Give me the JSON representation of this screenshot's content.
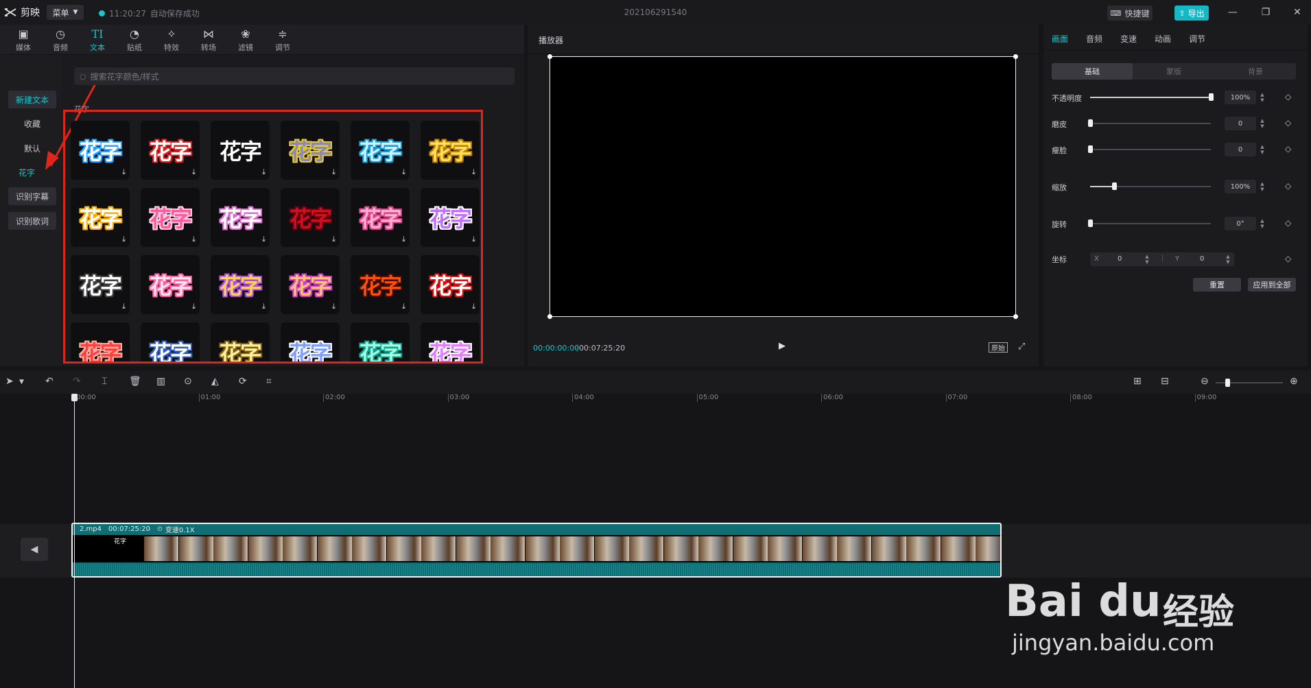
{
  "titlebar": {
    "logo": "剪映",
    "menu": "菜单",
    "autosave_time": "11:20:27",
    "autosave_text": "自动保存成功",
    "project_title": "202106291540",
    "shortcut": "快捷键",
    "export": "导出"
  },
  "toolbar": {
    "items": [
      {
        "label": "媒体",
        "icon": "media-icon"
      },
      {
        "label": "音频",
        "icon": "audio-icon"
      },
      {
        "label": "文本",
        "icon": "text-icon"
      },
      {
        "label": "贴纸",
        "icon": "sticker-icon"
      },
      {
        "label": "特效",
        "icon": "effects-icon"
      },
      {
        "label": "转场",
        "icon": "transition-icon"
      },
      {
        "label": "滤镜",
        "icon": "filter-icon"
      },
      {
        "label": "调节",
        "icon": "adjust-icon"
      }
    ],
    "active_index": 2
  },
  "sidebar": {
    "items": [
      "新建文本",
      "收藏",
      "默认",
      "花字",
      "识别字幕",
      "识别歌词"
    ],
    "active": "花字"
  },
  "search": {
    "placeholder": "搜索花字颜色/样式"
  },
  "grid": {
    "section_label": "花字",
    "tile_text": "花字",
    "styles": [
      {
        "fill": "#ffffff",
        "stroke": "#2aa6ff"
      },
      {
        "fill": "#ffffff",
        "stroke": "#e02020"
      },
      {
        "fill": "#ffffff",
        "stroke": "#111111"
      },
      {
        "fill": "#8a8aaa",
        "stroke": "#e8c830"
      },
      {
        "fill": "#c8f4ff",
        "stroke": "#1a9bd6"
      },
      {
        "fill": "#ffe060",
        "stroke": "#c08000"
      },
      {
        "fill": "#ffffff",
        "stroke": "#ffb000"
      },
      {
        "fill": "#ff5aa0",
        "stroke": "#ffd0e0"
      },
      {
        "fill": "#ffffff",
        "stroke": "#e070d0"
      },
      {
        "fill": "#d01020",
        "stroke": "#600010"
      },
      {
        "fill": "#ffb0d0",
        "stroke": "#e0408a"
      },
      {
        "fill": "#c070ff",
        "stroke": "#ffffff"
      },
      {
        "fill": "#ffffff",
        "stroke": "#404040"
      },
      {
        "fill": "#ffe0f0",
        "stroke": "#ff60a0"
      },
      {
        "fill": "#ffd060",
        "stroke": "#b050e0"
      },
      {
        "fill": "#ffc080",
        "stroke": "#d040c0"
      },
      {
        "fill": "#ff5010",
        "stroke": "#401000"
      },
      {
        "fill": "#ffffff",
        "stroke": "#e01010"
      },
      {
        "fill": "#ff4040",
        "stroke": "#ffb0a0"
      },
      {
        "fill": "#ffffff",
        "stroke": "#3060c0"
      },
      {
        "fill": "#fff0a0",
        "stroke": "#806010"
      },
      {
        "fill": "#80a0ff",
        "stroke": "#ffffff"
      },
      {
        "fill": "#a0ffe0",
        "stroke": "#10a090"
      },
      {
        "fill": "#e080ff",
        "stroke": "#ffffff"
      }
    ]
  },
  "player": {
    "title": "播放器",
    "current_time": "00:00:00:00",
    "total_time": "00:07:25:20",
    "original": "原始"
  },
  "properties": {
    "tabs": [
      "画面",
      "音频",
      "变速",
      "动画",
      "调节"
    ],
    "active_tab": "画面",
    "subtabs": [
      "基础",
      "蒙版",
      "背景"
    ],
    "active_subtab": "基础",
    "rows": [
      {
        "label": "不透明度",
        "value": "100%",
        "level": 1.0
      },
      {
        "label": "磨皮",
        "value": "0",
        "level": 0.0
      },
      {
        "label": "瘦脸",
        "value": "0",
        "level": 0.0
      },
      {
        "label": "缩放",
        "value": "100%",
        "level": 0.2
      },
      {
        "label": "旋转",
        "value": "0°",
        "level": 0.0
      }
    ],
    "coord_label": "坐标",
    "x_label": "X",
    "x_value": "0",
    "y_label": "Y",
    "y_value": "0",
    "reset": "重置",
    "apply_all": "应用到全部"
  },
  "timeline": {
    "ticks": [
      "00:00",
      "01:00",
      "02:00",
      "03:00",
      "04:00",
      "05:00",
      "06:00",
      "07:00",
      "08:00",
      "09:00"
    ],
    "clip": {
      "filename": "2.mp4",
      "duration": "00:07:25:20",
      "speed": "变速0.1X",
      "title_text": "花字"
    }
  },
  "watermark": {
    "brand": "Bai du",
    "cn": "经验",
    "url": "jingyan.baidu.com"
  }
}
